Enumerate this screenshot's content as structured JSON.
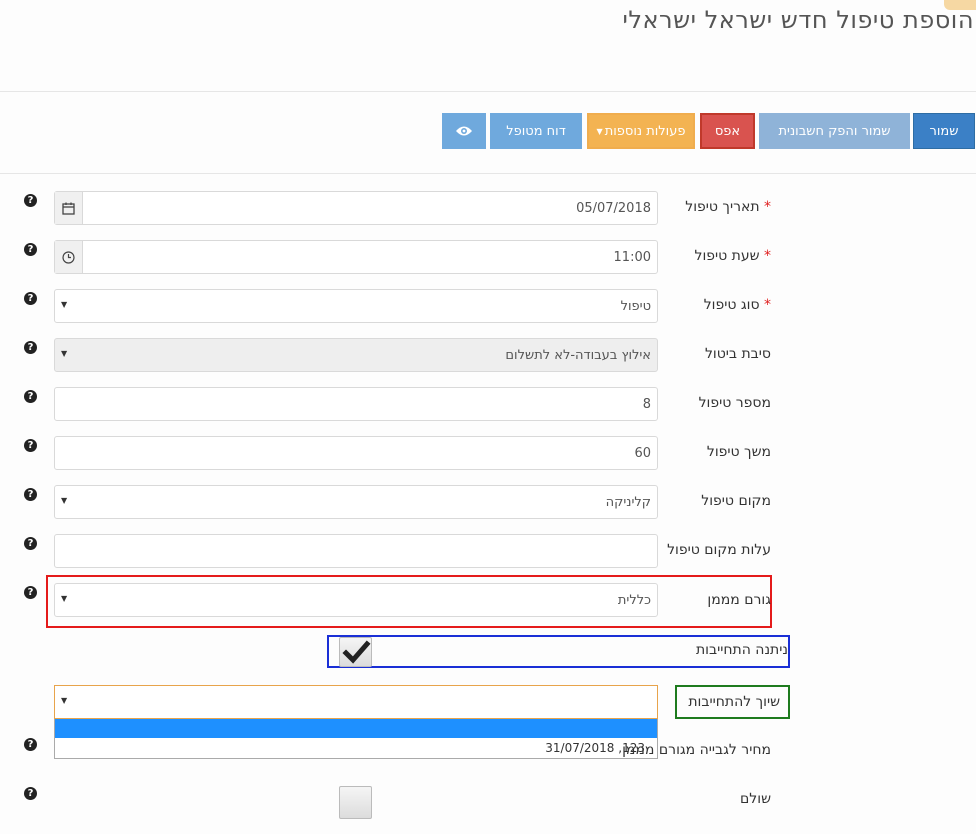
{
  "page": {
    "title": "הוספת טיפול חדש ישראל ישראלי"
  },
  "toolbar": {
    "save_label": "שמור",
    "save_invoice_label": "שמור והפק חשבונית",
    "reset_label": "אפס",
    "more_actions_label": "פעולות נוספות",
    "report_label": "דוח מטופל",
    "eye_icon": "eye-icon"
  },
  "form": {
    "date": {
      "label": "תאריך טיפול",
      "required_mark": "*",
      "value": "05/07/2018",
      "icon": "calendar-icon"
    },
    "time": {
      "label": "שעת טיפול",
      "required_mark": "*",
      "value": "11:00",
      "icon": "clock-icon"
    },
    "type": {
      "label": "סוג טיפול",
      "required_mark": "*",
      "value": "טיפול"
    },
    "cancel_reason": {
      "label": "סיבת ביטול",
      "value": "אילוץ בעבודה-לא לתשלום"
    },
    "number": {
      "label": "מספר טיפול",
      "value": "8"
    },
    "duration": {
      "label": "משך טיפול",
      "value": "60"
    },
    "location": {
      "label": "מקום טיפול",
      "value": "קליניקה"
    },
    "location_cost": {
      "label": "עלות מקום טיפול",
      "value": ""
    },
    "funder": {
      "label": "גורם מממן",
      "value": "כללית"
    },
    "commitment_given": {
      "label": "ניתנה התחייבות",
      "checked": true
    },
    "commitment_link": {
      "label": "שיוך להתחייבות",
      "value": "",
      "options": [
        "",
        "123, 31/07/2018"
      ]
    },
    "funder_price": {
      "label": "מחיר לגבייה מגורם מממן"
    },
    "paid": {
      "label": "שולם",
      "checked": false
    }
  },
  "help_icon_glyph": "?"
}
